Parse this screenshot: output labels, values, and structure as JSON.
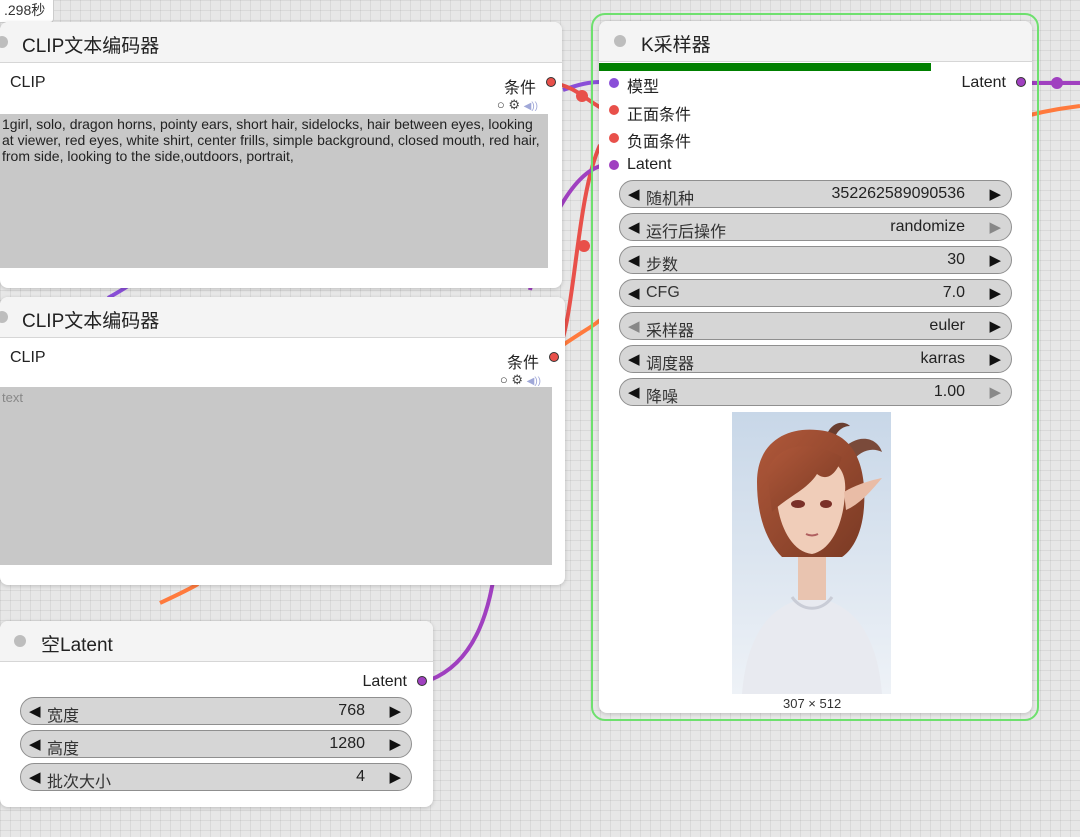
{
  "timer": ".298秒",
  "clip1": {
    "title": "CLIP文本编码器",
    "input_label": "CLIP",
    "output_label": "条件",
    "text": "1girl, solo, dragon horns, pointy ears, short hair, sidelocks, hair between eyes, looking at viewer, red eyes, white shirt, center frills, simple background, closed mouth, red hair, from side, looking to the side,outdoors, portrait,"
  },
  "clip2": {
    "title": "CLIP文本编码器",
    "input_label": "CLIP",
    "output_label": "条件",
    "placeholder": "text"
  },
  "empty_latent": {
    "title": "空Latent",
    "output_label": "Latent",
    "widgets": [
      {
        "label": "宽度",
        "value": "768"
      },
      {
        "label": "高度",
        "value": "1280"
      },
      {
        "label": "批次大小",
        "value": "4"
      }
    ]
  },
  "ksampler": {
    "title": "K采样器",
    "progress": 1.0,
    "inputs": [
      "模型",
      "正面条件",
      "负面条件",
      "Latent"
    ],
    "output_label": "Latent",
    "widgets": [
      {
        "label": "随机种",
        "value": "352262589090536"
      },
      {
        "label": "运行后操作",
        "value": "randomize"
      },
      {
        "label": "步数",
        "value": "30"
      },
      {
        "label": "CFG",
        "value": "7.0"
      },
      {
        "label": "采样器",
        "value": "euler"
      },
      {
        "label": "调度器",
        "value": "karras"
      },
      {
        "label": "降噪",
        "value": "1.00"
      }
    ],
    "image_size": "307 × 512"
  },
  "icons": {
    "arrow_left": "◀",
    "arrow_right": "▶",
    "circle": "○",
    "gear": "⚙",
    "speaker": "🔊"
  },
  "colors": {
    "model": "#8a4fd8",
    "conditioning": "#e8504a",
    "latent": "#a040c0",
    "wire_orange": "#ff7a3d",
    "selection": "#6ee06e",
    "progress": "#008000"
  }
}
